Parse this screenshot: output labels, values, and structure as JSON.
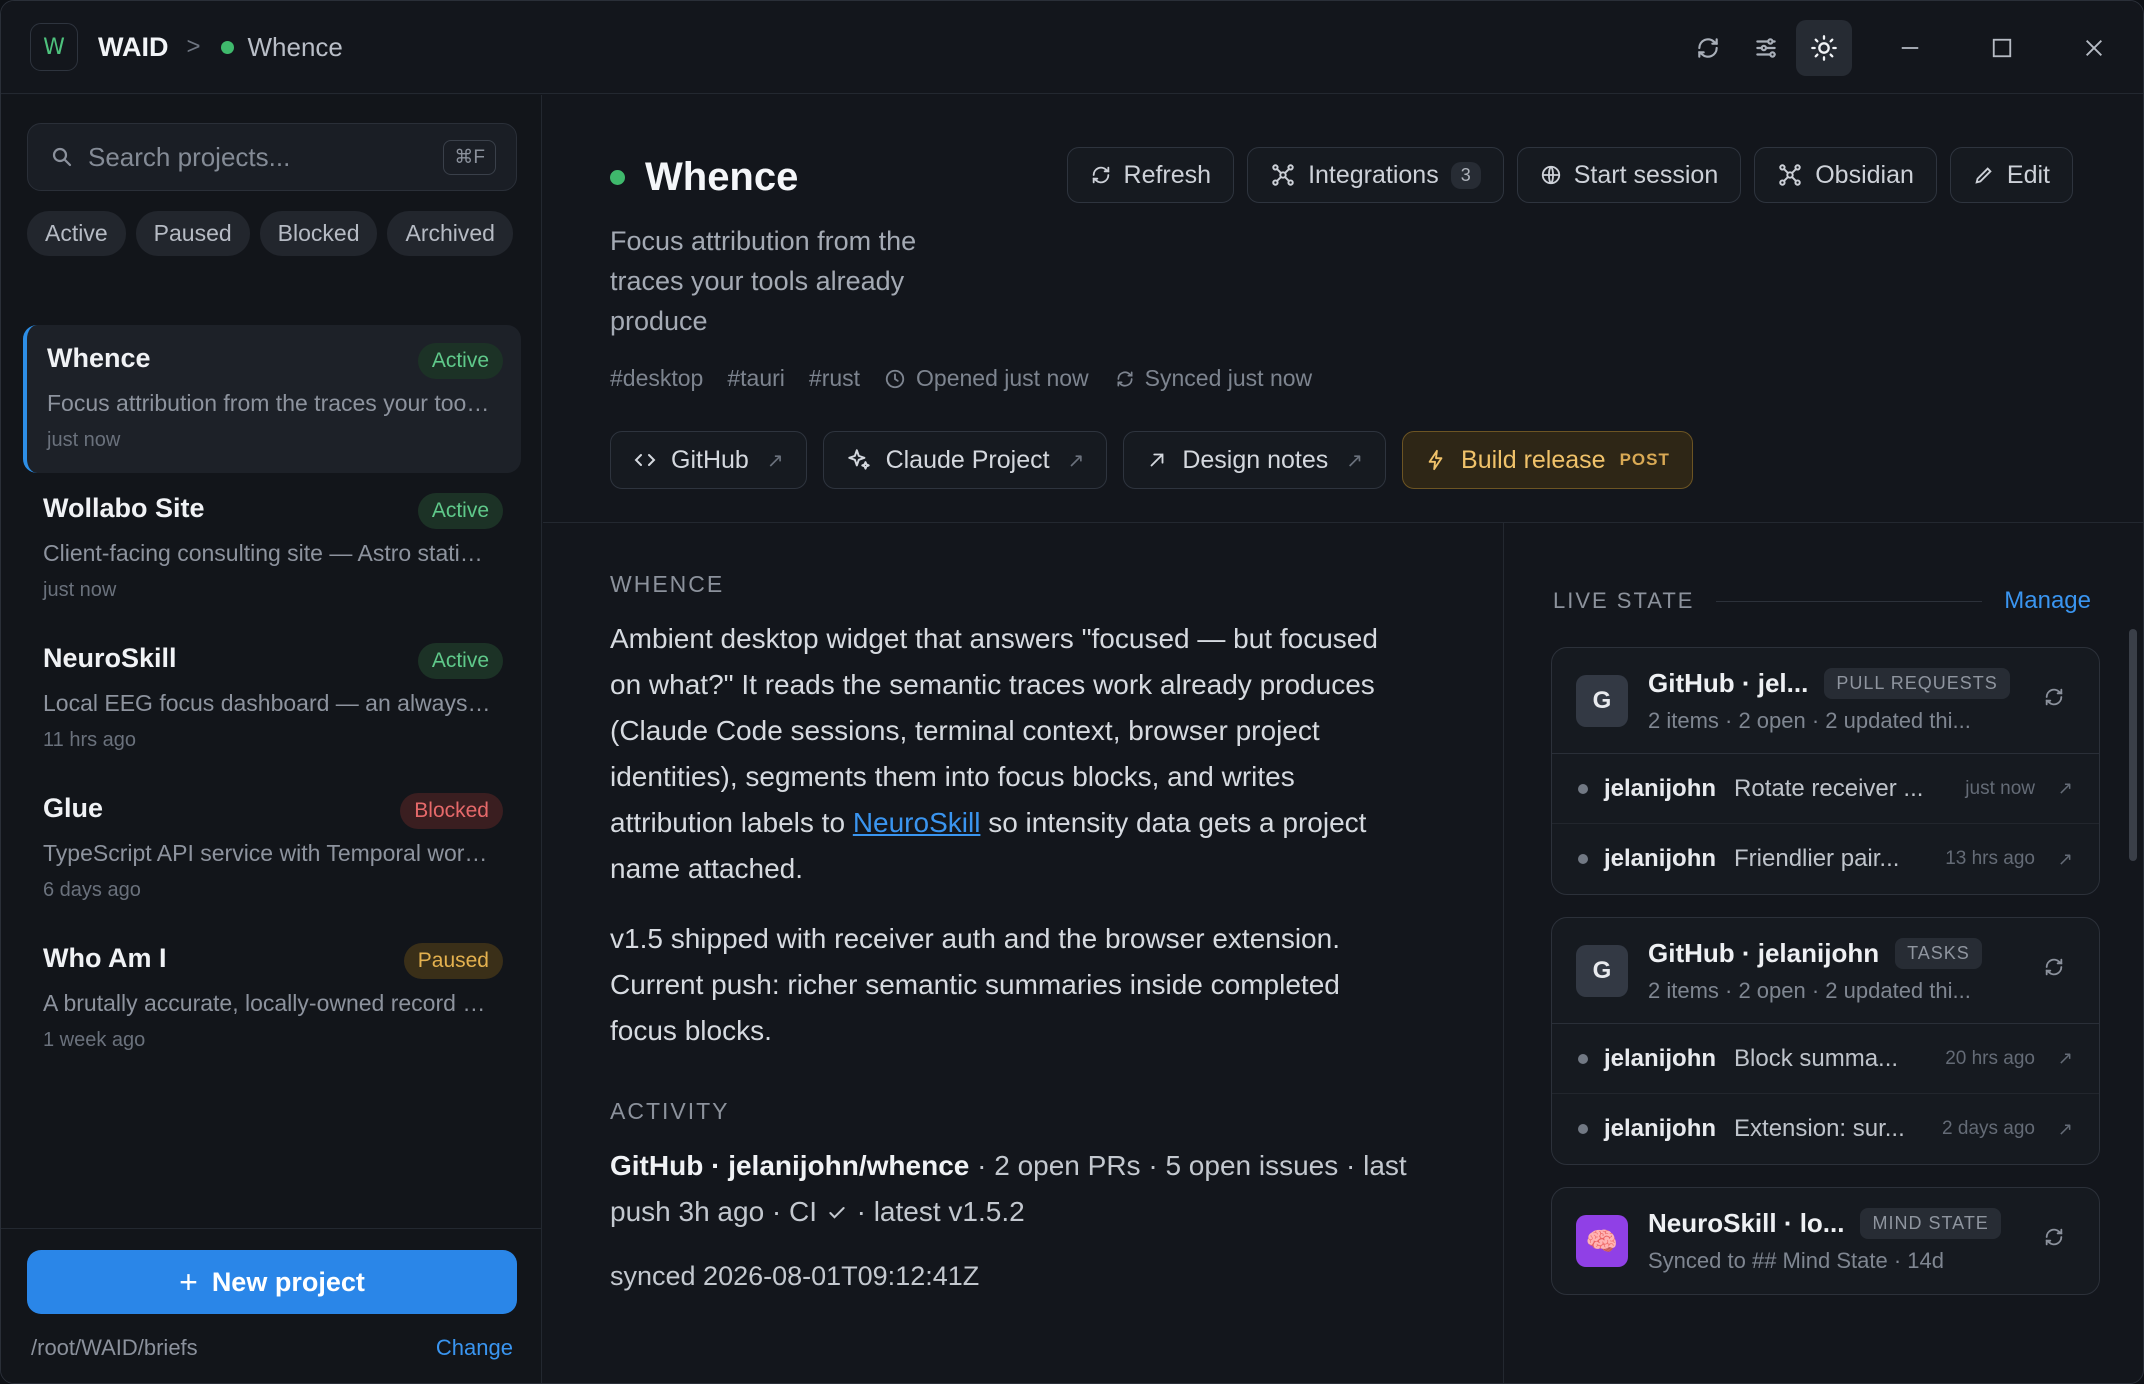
{
  "titlebar": {
    "app_logo": "W",
    "app_name": "WAID",
    "separator": ">",
    "current": "Whence"
  },
  "sidebar": {
    "search_placeholder": "Search projects...",
    "search_shortcut": "⌘F",
    "filters": [
      "Active",
      "Paused",
      "Blocked",
      "Archived"
    ],
    "projects": [
      {
        "name": "Whence",
        "status": "Active",
        "desc": "Focus attribution from the traces your tools already produce",
        "time": "just now"
      },
      {
        "name": "Wollabo Site",
        "status": "Active",
        "desc": "Client-facing consulting site — Astro static build",
        "time": "just now"
      },
      {
        "name": "NeuroSkill",
        "status": "Active",
        "desc": "Local EEG focus dashboard — an always-on monitor",
        "time": "11 hrs ago"
      },
      {
        "name": "Glue",
        "status": "Blocked",
        "desc": "TypeScript API service with Temporal workflows",
        "time": "6 days ago"
      },
      {
        "name": "Who Am I",
        "status": "Paused",
        "desc": "A brutally accurate, locally-owned record of who I am",
        "time": "1 week ago"
      }
    ],
    "new_project": "New project",
    "path": "/root/WAID/briefs",
    "change": "Change"
  },
  "header": {
    "title": "Whence",
    "subtitle": "Focus attribution from the traces your tools already produce",
    "tags": [
      "#desktop",
      "#tauri",
      "#rust"
    ],
    "opened": "Opened just now",
    "synced": "Synced just now",
    "actions": {
      "refresh": "Refresh",
      "integrations": "Integrations",
      "integrations_count": "3",
      "start_session": "Start session",
      "obsidian": "Obsidian",
      "edit": "Edit"
    },
    "links": {
      "github": "GitHub",
      "claude": "Claude Project",
      "design": "Design notes",
      "build": "Build release",
      "build_method": "POST"
    }
  },
  "content": {
    "section_title": "WHENCE",
    "para1_before": "Ambient desktop widget that answers \"focused — but focused on what?\" It reads the semantic traces work already produces (Claude Code sessions, terminal context, browser project identities), segments them into focus blocks, and writes attribution labels to ",
    "para1_link": "NeuroSkill",
    "para1_after": " so intensity data gets a project name attached.",
    "para2": "v1.5 shipped with receiver auth and the browser extension. Current push: richer semantic summaries inside completed focus blocks.",
    "activity_title": "ACTIVITY",
    "activity_repo": "GitHub · jelanijohn/whence",
    "activity_before_check": " · 2 open PRs · 5 open issues · last push 3h ago · CI ",
    "activity_after_check": " · latest v1.5.2",
    "synced_line": "synced 2026-08-01T09:12:41Z"
  },
  "live_state": {
    "title": "LIVE STATE",
    "manage": "Manage",
    "cards": [
      {
        "avatar": "G",
        "title": "GitHub · jel...",
        "kind": "PULL REQUESTS",
        "subtitle": "2 items · 2 open · 2 updated thi...",
        "items": [
          {
            "author": "jelanijohn",
            "title": "Rotate receiver ...",
            "time": "just now"
          },
          {
            "author": "jelanijohn",
            "title": "Friendlier pair...",
            "time": "13 hrs ago"
          }
        ]
      },
      {
        "avatar": "G",
        "title": "GitHub · jelanijohn",
        "kind": "TASKS",
        "subtitle": "2 items · 2 open · 2 updated thi...",
        "items": [
          {
            "author": "jelanijohn",
            "title": "Block summa...",
            "time": "20 hrs ago"
          },
          {
            "author": "jelanijohn",
            "title": "Extension: sur...",
            "time": "2 days ago"
          }
        ]
      },
      {
        "avatar": "🧠",
        "title": "NeuroSkill · lo...",
        "kind": "MIND STATE",
        "subtitle": "Synced to ## Mind State · 14d"
      }
    ]
  },
  "colors": {
    "accent": "#2a86e8",
    "active_dot": "#3fb96c",
    "status_active": "#5fc98a",
    "status_blocked": "#e6696a",
    "status_paused": "#e4b14f"
  }
}
